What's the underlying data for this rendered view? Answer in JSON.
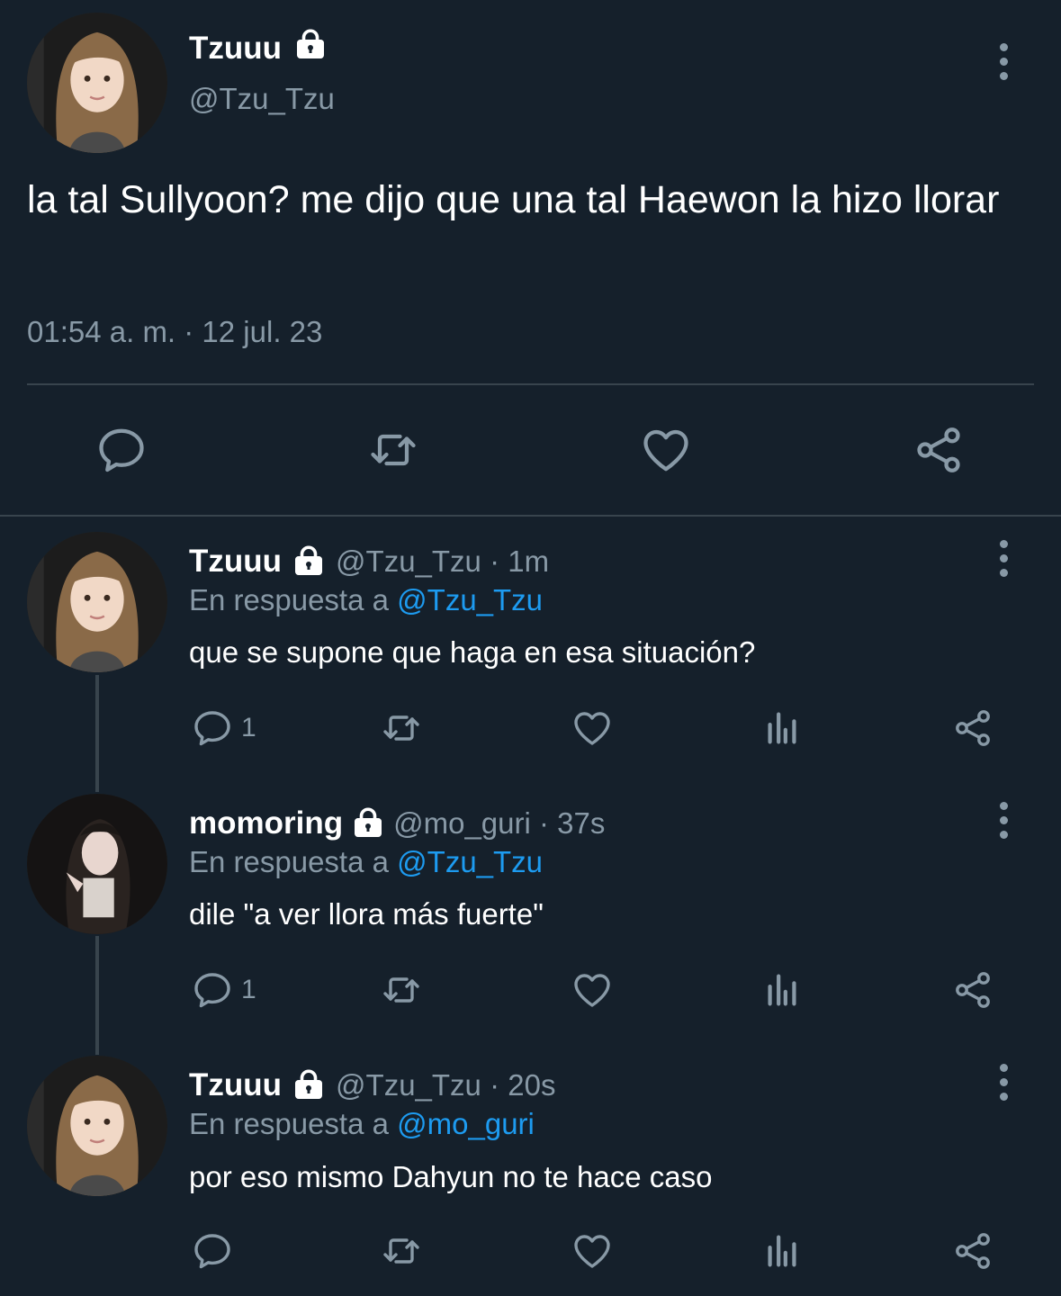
{
  "main_tweet": {
    "display_name": "Tzuuu",
    "handle": "@Tzu_Tzu",
    "text": "la tal Sullyoon? me dijo que una tal Haewon la hizo llorar",
    "timestamp": "01:54 a. m. · 12 jul. 23"
  },
  "replies": [
    {
      "display_name": "Tzuuu",
      "meta": "@Tzu_Tzu · 1m",
      "reply_prefix": "En respuesta a",
      "reply_to": "@Tzu_Tzu",
      "text": "que se supone que haga en esa situación?",
      "reply_count": "1"
    },
    {
      "display_name": "momoring",
      "meta": "@mo_guri · 37s",
      "reply_prefix": "En respuesta a",
      "reply_to": "@Tzu_Tzu",
      "text": "dile \"a ver llora más fuerte\"",
      "reply_count": "1"
    },
    {
      "display_name": "Tzuuu",
      "meta": "@Tzu_Tzu · 20s",
      "reply_prefix": "En respuesta a",
      "reply_to": "@mo_guri",
      "text": "por eso mismo Dahyun no te hace caso",
      "reply_count": ""
    }
  ],
  "icons": {
    "lock": "lock-icon",
    "more": "more-vertical-icon",
    "reply": "reply-icon",
    "retweet": "retweet-icon",
    "like": "heart-icon",
    "analytics": "analytics-icon",
    "share": "share-icon"
  },
  "colors": {
    "background": "#15202b",
    "muted": "#8899a6",
    "link": "#1d9bf0",
    "divider": "#38444d"
  }
}
